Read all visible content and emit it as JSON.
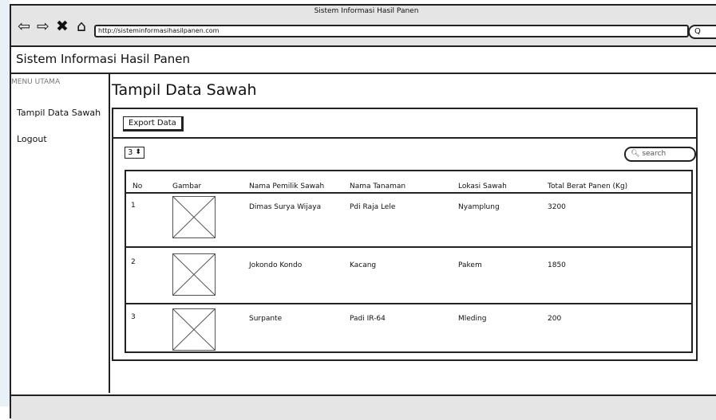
{
  "browser": {
    "title": "Sistem Informasi Hasil Panen",
    "url": "http://sisteminformasihasilpanen.com",
    "nav_icons": [
      "back-arrow-icon",
      "forward-arrow-icon",
      "close-icon",
      "home-icon"
    ],
    "search_glyph": "Q"
  },
  "app": {
    "title": "Sistem Informasi Hasil Panen"
  },
  "sidebar": {
    "heading": "MENU UTAMA",
    "items": [
      {
        "label": "Tampil Data Sawah"
      },
      {
        "label": "Logout"
      }
    ]
  },
  "main": {
    "page_title": "Tampil Data Sawah",
    "export_label": "Export Data",
    "page_size": "3",
    "search_placeholder": "search",
    "table": {
      "headers": [
        "No",
        "Gambar",
        "Nama Pemilik Sawah",
        "Nama Tanaman",
        "Lokasi Sawah",
        "Total Berat Panen (Kg)"
      ],
      "rows": [
        {
          "no": "1",
          "owner": "Dimas Surya Wijaya",
          "crop": "Pdi Raja Lele",
          "location": "Nyamplung",
          "weight": "3200"
        },
        {
          "no": "2",
          "owner": "Jokondo Kondo",
          "crop": "Kacang",
          "location": "Pakem",
          "weight": "1850"
        },
        {
          "no": "3",
          "owner": "Surpante",
          "crop": "Padi IR-64",
          "location": "Mleding",
          "weight": "200"
        }
      ]
    }
  }
}
